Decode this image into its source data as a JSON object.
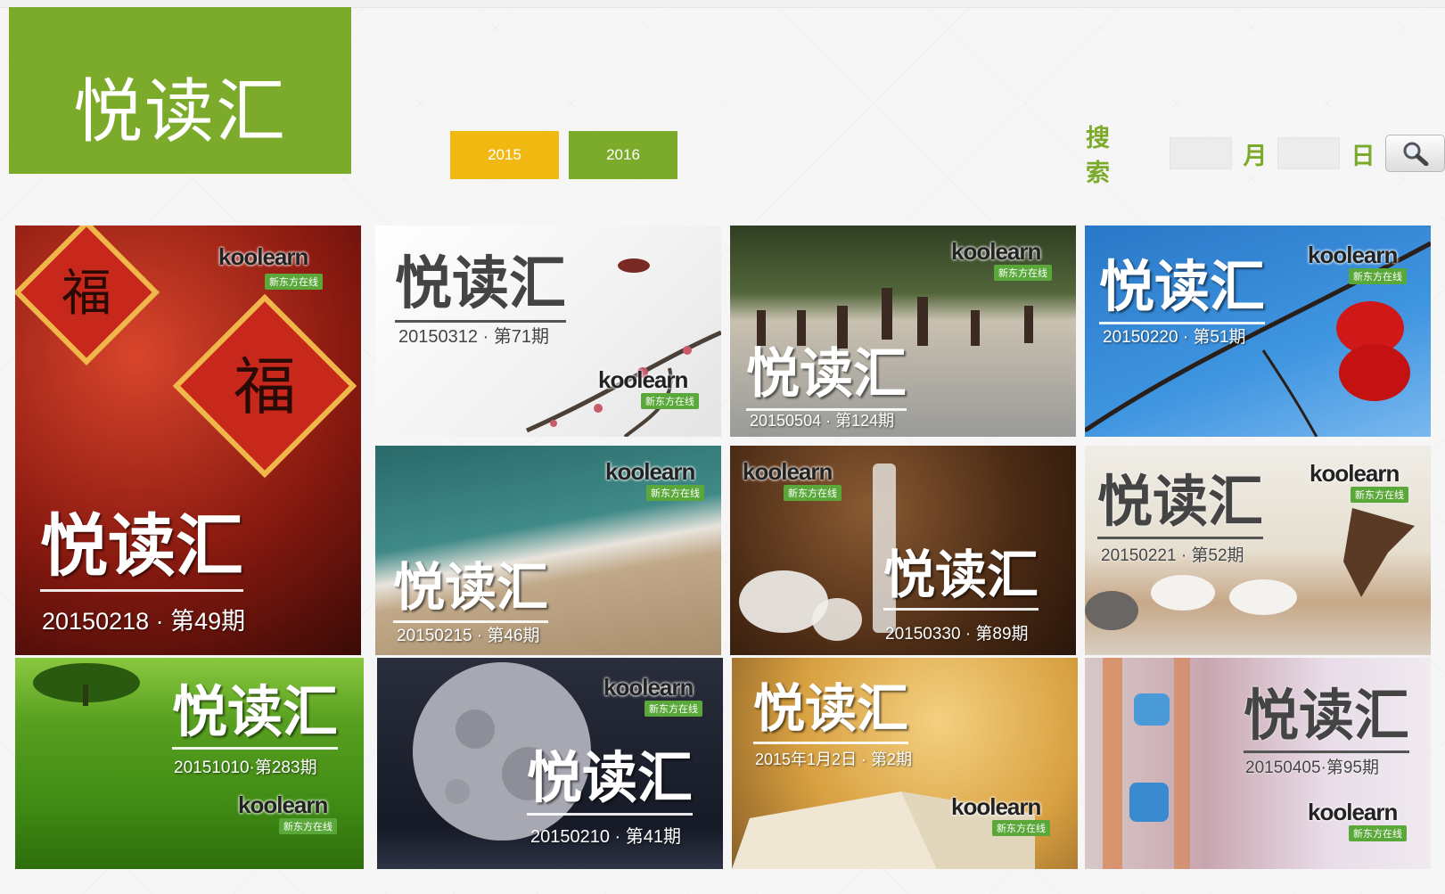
{
  "header": {
    "logo_text": "悦读汇"
  },
  "years": [
    {
      "label": "2015",
      "color": "#f2b812"
    },
    {
      "label": "2016",
      "color": "#7caa2b"
    }
  ],
  "search": {
    "label": "搜 索",
    "month_unit": "月",
    "day_unit": "日",
    "month_value": "",
    "day_value": "",
    "button_icon": "magnifier-icon"
  },
  "brand": {
    "name": "koolearn",
    "sub": "新东方在线"
  },
  "cards": [
    {
      "title": "悦读汇",
      "date": "20150218 · 第49期",
      "theme": "red"
    },
    {
      "title": "悦读汇",
      "date": "20150312 · 第71期",
      "theme": "ink"
    },
    {
      "title": "悦读汇",
      "date": "20150504 · 第124期",
      "theme": "beach"
    },
    {
      "title": "悦读汇",
      "date": "20150220 · 第51期",
      "theme": "sky"
    },
    {
      "title": "悦读汇",
      "date": "20150215 · 第46期",
      "theme": "sea"
    },
    {
      "title": "悦读汇",
      "date": "20150330 · 第89期",
      "theme": "chess"
    },
    {
      "title": "悦读汇",
      "date": "20150221 · 第52期",
      "theme": "birds"
    },
    {
      "title": "悦读汇",
      "date": "20151010·第283期",
      "theme": "grass"
    },
    {
      "title": "悦读汇",
      "date": "20150210 · 第41期",
      "theme": "moon"
    },
    {
      "title": "悦读汇",
      "date": "2015年1月2日 · 第2期",
      "theme": "book"
    },
    {
      "title": "悦读汇",
      "date": "20150405·第95期",
      "theme": "toy"
    }
  ]
}
